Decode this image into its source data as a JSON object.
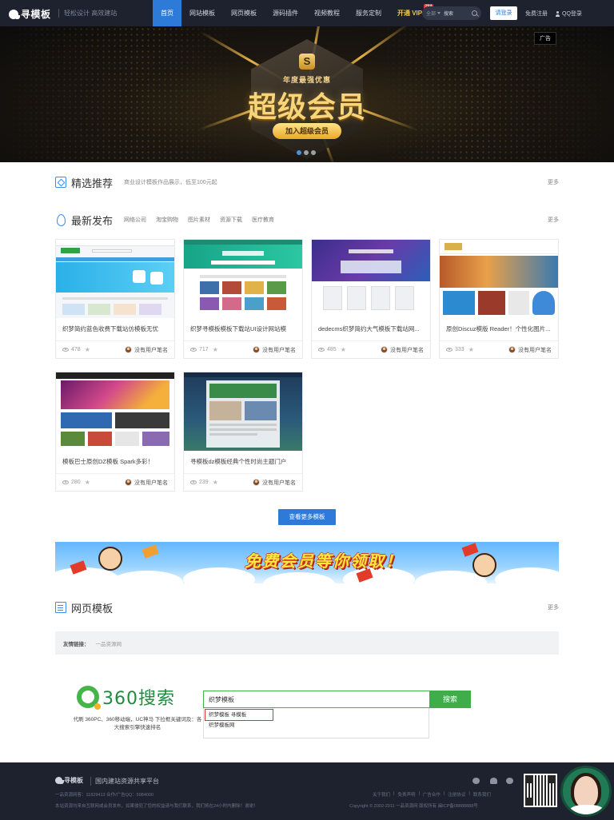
{
  "nav": {
    "logo": "寻模板",
    "slogan": "轻松设计 高效建站",
    "menu": [
      "首页",
      "网站模板",
      "网页模板",
      "源码插件",
      "视频教程",
      "服务定制",
      "开通 VIP"
    ],
    "hot": "Hot",
    "search_category": "全部",
    "search_placeholder": "搜索",
    "login": "请登录",
    "register": "免费注册",
    "qq_login": "QQ登录"
  },
  "banner": {
    "ad_label": "广告",
    "s_badge": "S",
    "subtitle": "年度最强优惠",
    "title": "超级会员",
    "button": "加入超级会员",
    "slide_count": 3,
    "active_slide": 1
  },
  "featured": {
    "title": "精选推荐",
    "desc": "商业设计模板作品展示，低至100元起",
    "more": "更多"
  },
  "latest": {
    "title": "最新发布",
    "tabs": [
      "网络公司",
      "淘宝购物",
      "图片素材",
      "资源下载",
      "医疗教育"
    ],
    "more": "更多",
    "cards": [
      {
        "title": "织梦简约蓝色收费下载站仿模板无忧",
        "views": "478",
        "author": "没有用户笔名"
      },
      {
        "title": "织梦寻模板模板下载站UI设计网站模",
        "views": "717",
        "author": "没有用户笔名"
      },
      {
        "title": "dedecms织梦简约大气模板下载站网...",
        "views": "485",
        "author": "没有用户笔名"
      },
      {
        "title": "原创Discuz模版 Reader！个性化图片...",
        "views": "333",
        "author": "没有用户笔名"
      },
      {
        "title": "模板巴士原创DZ模板 Spark多彩！",
        "views": "280",
        "author": "没有用户笔名"
      },
      {
        "title": "寻模板dz模板经典个性时尚主题门户",
        "views": "239",
        "author": "没有用户笔名"
      }
    ],
    "more_button": "查看更多模板"
  },
  "promo": {
    "text": "免费会员等你领取！"
  },
  "webpage": {
    "title": "网页模板",
    "more": "更多"
  },
  "links": {
    "label": "友情链接：",
    "items": [
      "一品资源网"
    ]
  },
  "search360": {
    "brand": "360搜索",
    "desc": "代刷 360PC、360移动端，UC神马 下拉框关键词及：各大搜索引擎快速排名",
    "query": "织梦模板",
    "button": "搜索",
    "suggestions": [
      "织梦模板 寻模板",
      "织梦模板网"
    ]
  },
  "footer": {
    "logo": "寻模板",
    "slogan": "国内建站资源共享平台",
    "contact": "一品资源网客：11829413 合作/广告QQ：5984000",
    "notice": "本站资源均来自互联网或会员发布，如果侵犯了您的权益请与我们联系，我们将在24小时内删除！谢谢！",
    "links": [
      "关于我们",
      "|",
      "免责声明",
      "|",
      "广告合作",
      "|",
      "注册协议",
      "|",
      "联系我们"
    ],
    "copyright": "Copyright © 2002-2011 一品资源网 版权所有 闽ICP备08888888号"
  },
  "colors": {
    "nav_bg": "#1d222e",
    "accent": "#2d7ad9",
    "vip": "#f4c74a",
    "gold": "#f7d57a",
    "green_360": "#3fad49"
  }
}
